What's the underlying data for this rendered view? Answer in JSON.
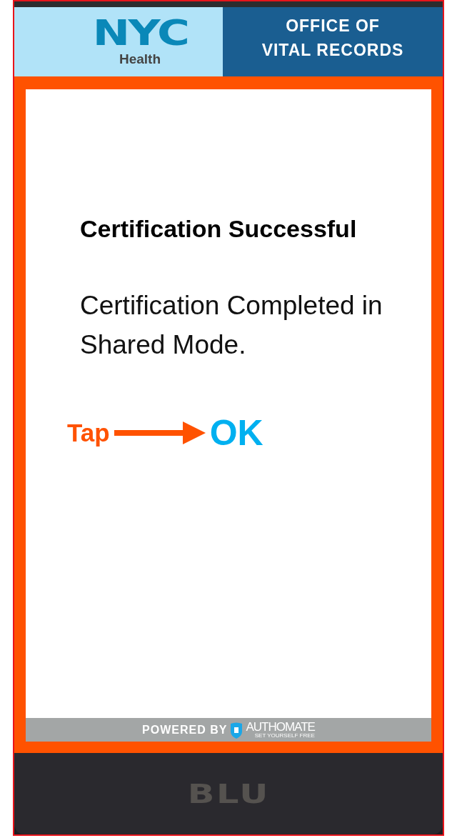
{
  "header": {
    "logo": "NYC",
    "logo_sub": "Health",
    "title_lines": [
      "OFFICE OF",
      "VITAL RECORDS"
    ]
  },
  "dialog": {
    "title": "Certification Successful",
    "message": "Certification Completed in Shared Mode.",
    "button": "OK"
  },
  "annotation": {
    "label": "Tap"
  },
  "footer": {
    "powered_by": "POWERED BY",
    "brand": "AUTHOMATE",
    "tagline": "SET YOURSELF FREE"
  },
  "device": {
    "brand": "BLU"
  }
}
